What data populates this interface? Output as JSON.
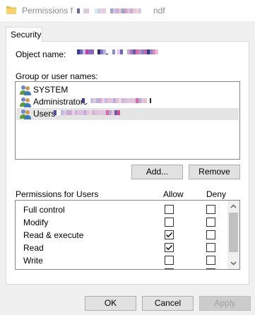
{
  "window": {
    "title_prefix": "Permissions f",
    "title_suffix": "ndf"
  },
  "tabs": [
    {
      "label": "Security"
    }
  ],
  "security": {
    "object_name_label": "Object name:",
    "group_label": "Group or user names:",
    "users": [
      {
        "label": "SYSTEM"
      },
      {
        "label": "Administrators"
      },
      {
        "label": "Users"
      }
    ],
    "add_button": "Add...",
    "remove_button": "Remove",
    "permissions_header": "Permissions for Users",
    "allow_header": "Allow",
    "deny_header": "Deny",
    "permissions": [
      {
        "name": "Full control",
        "allow": false,
        "deny": false
      },
      {
        "name": "Modify",
        "allow": false,
        "deny": false
      },
      {
        "name": "Read & execute",
        "allow": true,
        "deny": false
      },
      {
        "name": "Read",
        "allow": true,
        "deny": false
      },
      {
        "name": "Write",
        "allow": false,
        "deny": false
      }
    ]
  },
  "footer": {
    "ok": "OK",
    "cancel": "Cancel",
    "apply": "Apply"
  },
  "icons": [
    "folder-icon",
    "users-icon",
    "checkmark-icon",
    "scroll-up-icon",
    "scroll-down-icon"
  ]
}
